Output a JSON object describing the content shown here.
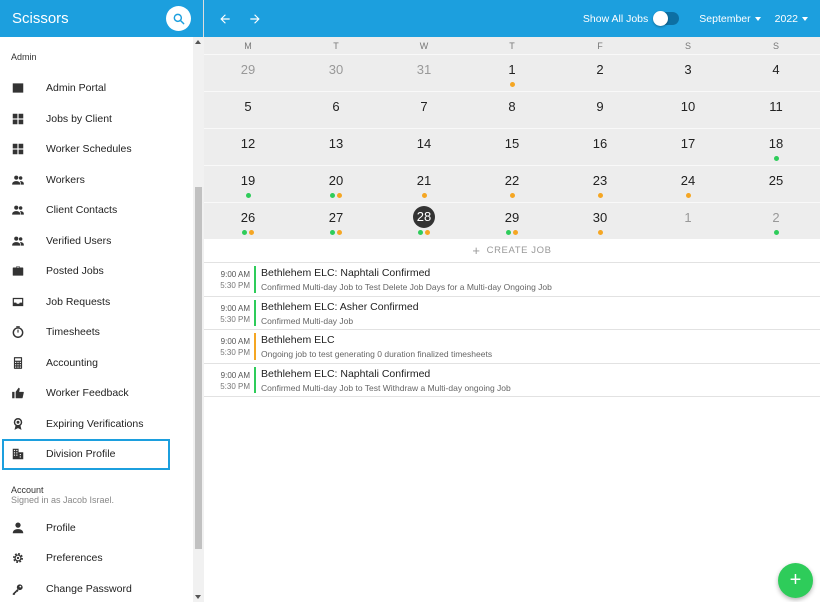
{
  "app": {
    "title": "Scissors"
  },
  "sidebar": {
    "admin_label": "Admin",
    "admin_items": [
      {
        "label": "Admin Portal",
        "icon": "admin-portal-icon"
      },
      {
        "label": "Jobs by Client",
        "icon": "grid-icon"
      },
      {
        "label": "Worker Schedules",
        "icon": "grid-icon"
      },
      {
        "label": "Workers",
        "icon": "people-icon"
      },
      {
        "label": "Client Contacts",
        "icon": "people-icon"
      },
      {
        "label": "Verified Users",
        "icon": "people-icon"
      },
      {
        "label": "Posted Jobs",
        "icon": "briefcase-icon"
      },
      {
        "label": "Job Requests",
        "icon": "inbox-icon"
      },
      {
        "label": "Timesheets",
        "icon": "timer-icon"
      },
      {
        "label": "Accounting",
        "icon": "calculator-icon"
      },
      {
        "label": "Worker Feedback",
        "icon": "thumbs-up-icon"
      },
      {
        "label": "Expiring Verifications",
        "icon": "award-icon"
      },
      {
        "label": "Division Profile",
        "icon": "building-icon",
        "active": true
      }
    ],
    "account_label": "Account",
    "signed_in_text": "Signed in as Jacob Israel.",
    "account_items": [
      {
        "label": "Profile",
        "icon": "person-icon"
      },
      {
        "label": "Preferences",
        "icon": "settings-icon"
      },
      {
        "label": "Change Password",
        "icon": "key-icon"
      }
    ]
  },
  "topbar": {
    "show_all_label": "Show All Jobs",
    "show_all_enabled": false,
    "month": "September",
    "year": "2022"
  },
  "calendar": {
    "weekdays": [
      "M",
      "T",
      "W",
      "T",
      "F",
      "S",
      "S"
    ],
    "weeks": [
      [
        {
          "d": "29",
          "other": true
        },
        {
          "d": "30",
          "other": true
        },
        {
          "d": "31",
          "other": true
        },
        {
          "d": "1",
          "dots": [
            "orange"
          ]
        },
        {
          "d": "2"
        },
        {
          "d": "3"
        },
        {
          "d": "4"
        }
      ],
      [
        {
          "d": "5"
        },
        {
          "d": "6"
        },
        {
          "d": "7"
        },
        {
          "d": "8"
        },
        {
          "d": "9"
        },
        {
          "d": "10"
        },
        {
          "d": "11"
        }
      ],
      [
        {
          "d": "12"
        },
        {
          "d": "13"
        },
        {
          "d": "14"
        },
        {
          "d": "15"
        },
        {
          "d": "16"
        },
        {
          "d": "17"
        },
        {
          "d": "18",
          "dots": [
            "green"
          ]
        }
      ],
      [
        {
          "d": "19",
          "dots": [
            "green"
          ]
        },
        {
          "d": "20",
          "dots": [
            "green",
            "orange"
          ]
        },
        {
          "d": "21",
          "dots": [
            "orange"
          ]
        },
        {
          "d": "22",
          "dots": [
            "orange"
          ]
        },
        {
          "d": "23",
          "dots": [
            "orange"
          ]
        },
        {
          "d": "24",
          "dots": [
            "orange"
          ]
        },
        {
          "d": "25"
        }
      ],
      [
        {
          "d": "26",
          "dots": [
            "green",
            "orange"
          ]
        },
        {
          "d": "27",
          "dots": [
            "green",
            "orange"
          ]
        },
        {
          "d": "28",
          "today": true,
          "dots": [
            "green",
            "orange"
          ]
        },
        {
          "d": "29",
          "dots": [
            "green",
            "orange"
          ]
        },
        {
          "d": "30",
          "dots": [
            "orange"
          ]
        },
        {
          "d": "1",
          "other": true
        },
        {
          "d": "2",
          "other": true,
          "dots": [
            "green"
          ]
        }
      ]
    ]
  },
  "create_job_label": "CREATE JOB",
  "jobs": [
    {
      "start": "9:00 AM",
      "end": "5:30 PM",
      "title": "Bethlehem ELC: Naphtali Confirmed",
      "desc": "Confirmed Multi-day Job to Test Delete Job Days for a Multi-day Ongoing Job",
      "status": "green"
    },
    {
      "start": "9:00 AM",
      "end": "5:30 PM",
      "title": "Bethlehem ELC: Asher Confirmed",
      "desc": "Confirmed Multi-day Job",
      "status": "green"
    },
    {
      "start": "9:00 AM",
      "end": "5:30 PM",
      "title": "Bethlehem ELC",
      "desc": "Ongoing job to test generating 0 duration finalized timesheets",
      "status": "orange"
    },
    {
      "start": "9:00 AM",
      "end": "5:30 PM",
      "title": "Bethlehem ELC: Naphtali Confirmed",
      "desc": "Confirmed Multi-day Job to Test Withdraw a Multi-day ongoing Job",
      "status": "green"
    }
  ],
  "fab": {
    "label": "+"
  },
  "colors": {
    "brand": "#1c9fde",
    "green": "#2ecc5a",
    "orange": "#f5a623"
  }
}
